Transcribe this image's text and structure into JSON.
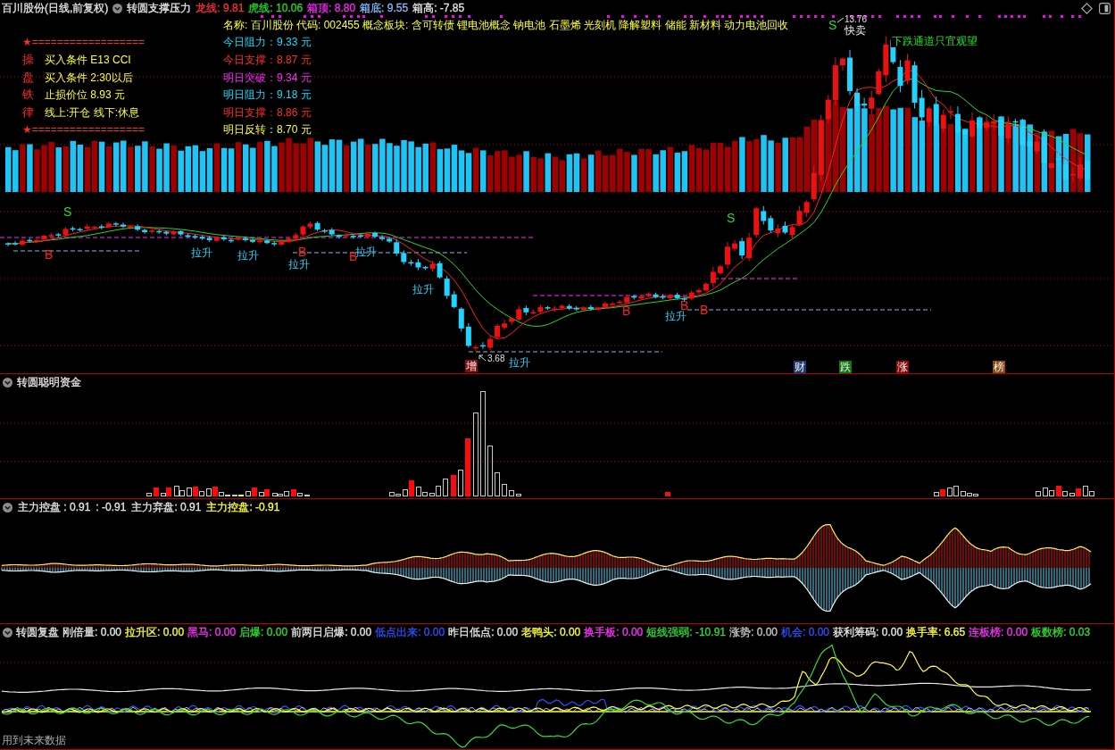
{
  "header": {
    "title": "百川股份(日线,前复权)",
    "indicator": "转圆支撑压力",
    "legend": [
      {
        "text": "龙线: 9.81",
        "color": "#ff3030"
      },
      {
        "text": "虎线: 10.06",
        "color": "#22dd22"
      },
      {
        "text": "箱顶: 8.80",
        "color": "#ff22ff"
      },
      {
        "text": "箱底: 9.55",
        "color": "#88bbff"
      },
      {
        "text": "箱高: -7.85",
        "color": "#e6e6e6"
      }
    ]
  },
  "rules": [
    {
      "kind": "divider",
      "text": "★=================="
    },
    {
      "kind": "rule",
      "mark": "操",
      "text": "买入条件 E13 CCI"
    },
    {
      "kind": "rule",
      "mark": "盘",
      "text": "买入条件 2:30以后"
    },
    {
      "kind": "rule",
      "mark": "铁",
      "text": "止损价位 8.93 元"
    },
    {
      "kind": "rule",
      "mark": "律",
      "text": "线上:开仓 线下:休息"
    },
    {
      "kind": "divider",
      "text": "★=================="
    }
  ],
  "stock_info": {
    "summary": "名称: 百川股份 代码: 002455 概念板块: 含可转债 锂电池概念 钠电池 石墨烯 光刻机 降解塑料 储能 新材料 动力电池回收",
    "levels": [
      {
        "text": "今日阻力：9.33 元",
        "color": "#00e0ff"
      },
      {
        "text": "今日支撑：8.87 元",
        "color": "#ff2a2a"
      },
      {
        "text": "明日突破：9.34 元",
        "color": "#ff22ff"
      },
      {
        "text": "明日阻力：9.18 元",
        "color": "#00e0ff"
      },
      {
        "text": "明日支撑：8.86 元",
        "color": "#ff2a2a"
      },
      {
        "text": "明日反转：8.70 元",
        "color": "#ffff33"
      }
    ]
  },
  "main_chart": {
    "markers": [
      {
        "kind": "buy",
        "text": "B"
      },
      {
        "kind": "sell",
        "text": "S"
      },
      {
        "kind": "buy",
        "text": "B"
      },
      {
        "kind": "buy",
        "text": "B"
      },
      {
        "kind": "buy",
        "text": "B"
      },
      {
        "kind": "buy",
        "text": "B"
      },
      {
        "kind": "buy",
        "text": "B"
      },
      {
        "kind": "sell",
        "text": "S"
      },
      {
        "kind": "sell",
        "text": "S"
      }
    ],
    "rise_labels": [
      "拉升",
      "拉升",
      "拉升",
      "拉升",
      "拉升",
      "拉升",
      "拉升"
    ],
    "price_labels": [
      "13.76",
      "3.68"
    ],
    "notes": [
      {
        "kind": "sell",
        "text": "快卖"
      },
      {
        "kind": "trend",
        "text": "下跌通道只宜观望"
      }
    ],
    "event_tags": [
      {
        "text": "增",
        "color": "#8a0c0c"
      },
      {
        "text": "财",
        "color": "#1d3a73"
      },
      {
        "text": "跌",
        "color": "#117711"
      },
      {
        "text": "涨",
        "color": "#8a0c0c"
      },
      {
        "text": "榜",
        "color": "#8a4a14"
      }
    ]
  },
  "smart_money_panel": {
    "title": "转圆聪明资金"
  },
  "control_panel": {
    "legend": [
      {
        "text": "主力控盘 : 0.91",
        "color": "#e6e6e6"
      },
      {
        "text": ": -0.91",
        "color": "#e6e6e6"
      },
      {
        "text": "主力弃盘: 0.91",
        "color": "#e6e6e6"
      },
      {
        "text": "主力控盘: -0.91",
        "color": "#ffff33"
      }
    ]
  },
  "review_panel": {
    "title": "转圆复盘",
    "legend": [
      {
        "text": "刚倍量: 0.00",
        "color": "#e6e6e6"
      },
      {
        "text": "拉升区: 0.00",
        "color": "#ffff33"
      },
      {
        "text": "黑马: 0.00",
        "color": "#ff33ff"
      },
      {
        "text": "启爆: 0.00",
        "color": "#33dd33"
      },
      {
        "text": "前两日启爆: 0.00",
        "color": "#e6e6e6"
      },
      {
        "text": "低点出来: 0.00",
        "color": "#3050ff"
      },
      {
        "text": "昨日低点: 0.00",
        "color": "#e6e6e6"
      },
      {
        "text": "老鸭头: 0.00",
        "color": "#ffff33"
      },
      {
        "text": "换手板: 0.00",
        "color": "#ff33ff"
      },
      {
        "text": "短线强弱: -10.91",
        "color": "#33dd33"
      },
      {
        "text": "涨势: 0.00",
        "color": "#c8c8c8"
      },
      {
        "text": "机会: 0.00",
        "color": "#3050ff"
      },
      {
        "text": "获利筹码: 0.00",
        "color": "#e6e6e6"
      },
      {
        "text": "换手率: 6.65",
        "color": "#ffff33"
      },
      {
        "text": "连板榜: 0.00",
        "color": "#ff33ff"
      },
      {
        "text": "板数榜: 0.03",
        "color": "#33dd33"
      }
    ],
    "footnote": "用到未来数据"
  }
}
